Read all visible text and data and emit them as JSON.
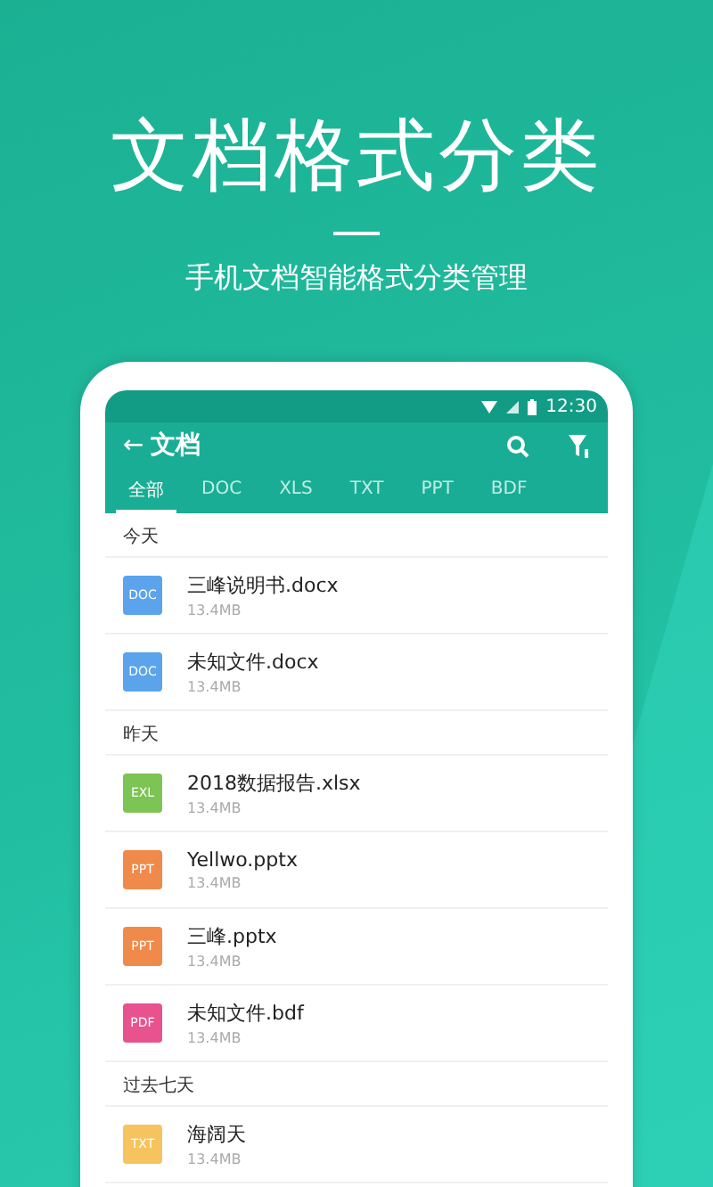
{
  "headline": "文档格式分类",
  "subtitle": "手机文档智能格式分类管理",
  "status_bar": {
    "time": "12:30"
  },
  "app_bar": {
    "back": "←",
    "title": "文档"
  },
  "tabs": [
    {
      "label": "全部",
      "selected": true
    },
    {
      "label": "DOC",
      "selected": false
    },
    {
      "label": "XLS",
      "selected": false
    },
    {
      "label": "TXT",
      "selected": false
    },
    {
      "label": "PPT",
      "selected": false
    },
    {
      "label": "BDF",
      "selected": false
    }
  ],
  "sections": [
    {
      "label": "今天",
      "files": [
        {
          "badge": "DOC",
          "color": "#5ba4ec",
          "name": "三峰说明书.docx",
          "size": "13.4MB"
        },
        {
          "badge": "DOC",
          "color": "#5ba4ec",
          "name": "未知文件.docx",
          "size": "13.4MB"
        }
      ]
    },
    {
      "label": "昨天",
      "files": [
        {
          "badge": "EXL",
          "color": "#7cc453",
          "name": "2018数据报告.xlsx",
          "size": "13.4MB"
        },
        {
          "badge": "PPT",
          "color": "#f08a4b",
          "name": "Yellwo.pptx",
          "size": "13.4MB"
        },
        {
          "badge": "PPT",
          "color": "#f08a4b",
          "name": "三峰.pptx",
          "size": "13.4MB"
        },
        {
          "badge": "PDF",
          "color": "#e8528f",
          "name": "未知文件.bdf",
          "size": "13.4MB"
        }
      ]
    },
    {
      "label": "过去七天",
      "files": [
        {
          "badge": "TXT",
          "color": "#f6c35f",
          "name": "海阔天",
          "size": "13.4MB"
        }
      ]
    }
  ]
}
